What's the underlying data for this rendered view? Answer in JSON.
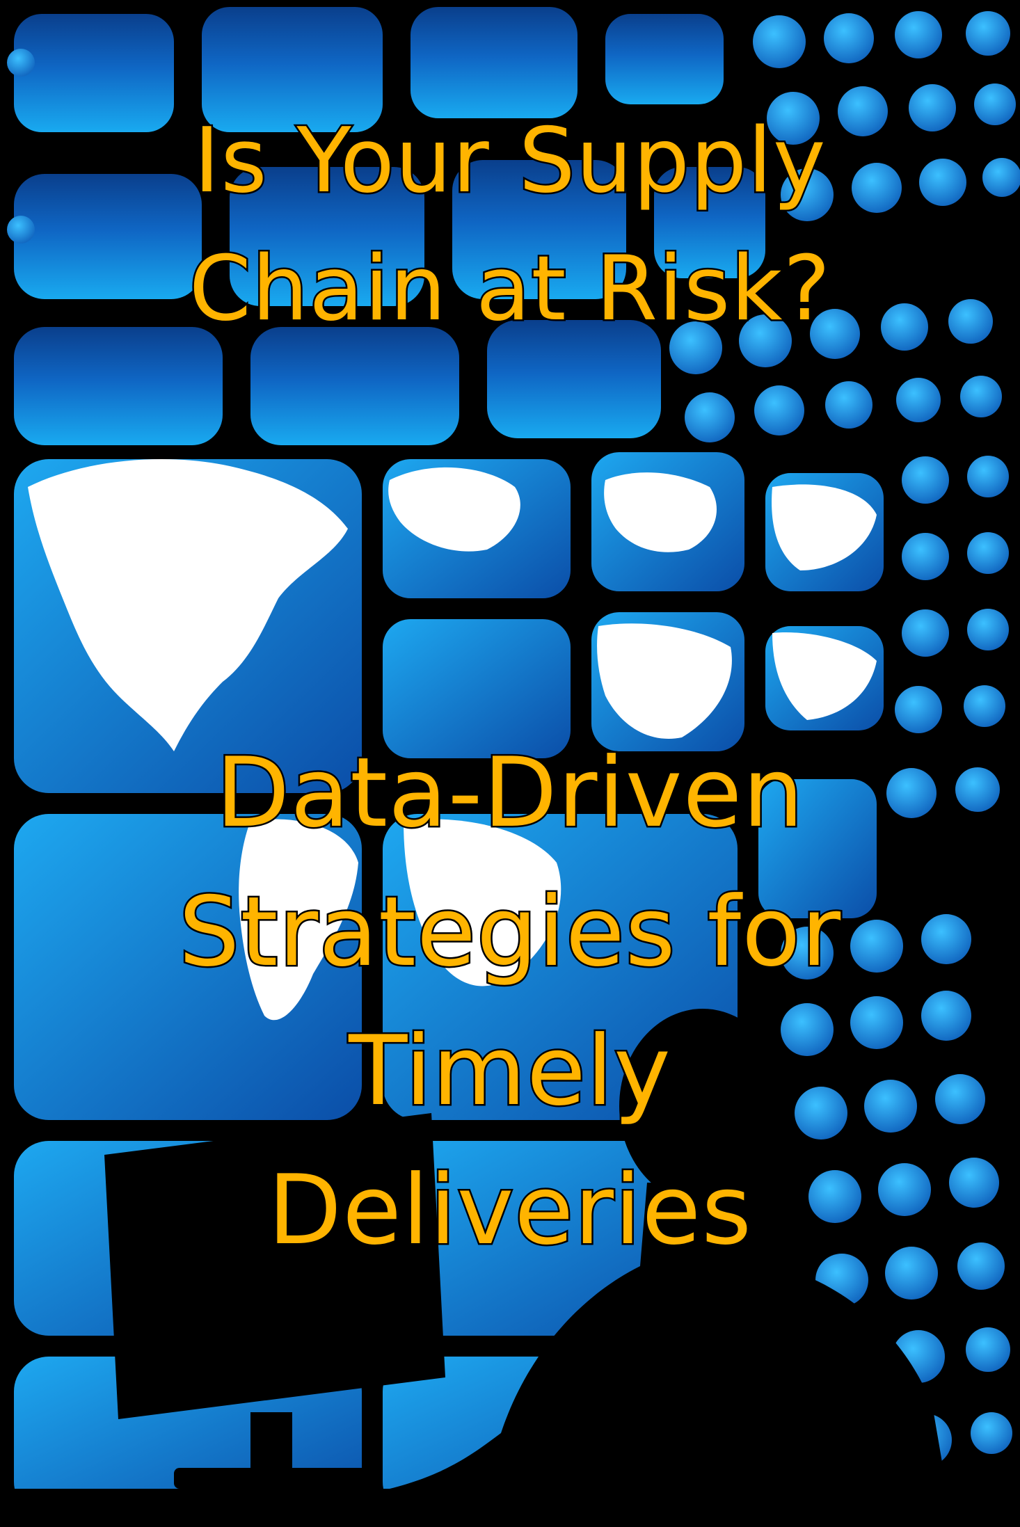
{
  "poster": {
    "question_lines": [
      "Is Your Supply",
      "Chain at Risk?"
    ],
    "subtitle_lines": [
      "Data-Driven",
      "Strategies for",
      "Timely",
      "Deliveries"
    ],
    "colors": {
      "headline_fill": "#ffb400",
      "headline_outline": "#000000",
      "tile_blue_dark": "#0a3f8c",
      "tile_blue_light": "#19aaf0",
      "continent_white": "#ffffff",
      "silhouette": "#000000"
    }
  }
}
